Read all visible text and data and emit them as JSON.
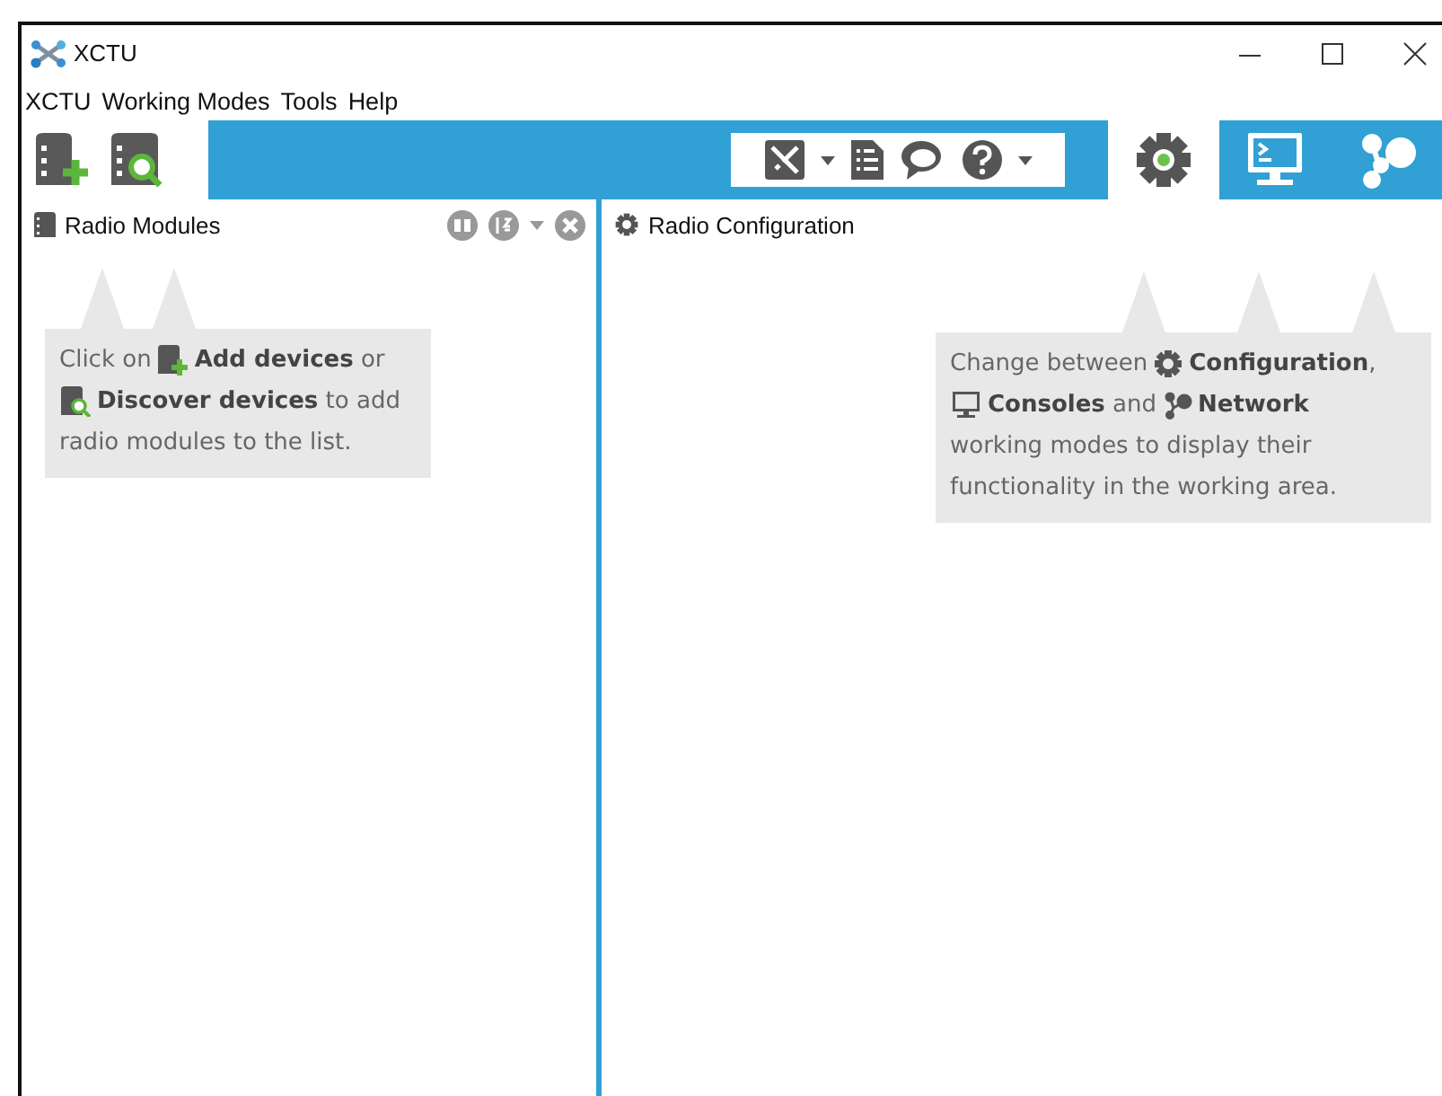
{
  "window": {
    "title": "XCTU"
  },
  "menu": [
    "XCTU",
    "Working Modes",
    "Tools",
    "Help"
  ],
  "device_buttons": [
    {
      "kind": "add"
    },
    {
      "kind": "discover"
    }
  ],
  "tools": [
    {
      "kind": "tools",
      "caret": true
    },
    {
      "kind": "list",
      "caret": false
    },
    {
      "kind": "chat",
      "caret": false
    },
    {
      "kind": "help",
      "caret": true
    }
  ],
  "modes": [
    {
      "kind": "gear",
      "selected": true
    },
    {
      "kind": "console",
      "selected": false
    },
    {
      "kind": "network",
      "selected": false
    }
  ],
  "left_panel": {
    "title": "Radio Modules",
    "hint": [
      [
        {
          "kind": "text",
          "text": "Click on "
        },
        {
          "kind": "add"
        },
        {
          "kind": "text",
          "text": " **Add devices** or"
        }
      ],
      [
        {
          "kind": "discover"
        },
        {
          "kind": "text",
          "text": " **Discover devices** to add"
        }
      ],
      [
        {
          "kind": "text",
          "text": "radio modules to the list."
        }
      ]
    ]
  },
  "right_panel": {
    "title": "Radio Configuration",
    "hint": [
      [
        {
          "kind": "text",
          "text": "Change between "
        },
        {
          "kind": "gear"
        },
        {
          "kind": "text",
          "text": " **Configuration**,"
        }
      ],
      [
        {
          "kind": "console"
        },
        {
          "kind": "text",
          "text": " **Consoles** and "
        },
        {
          "kind": "network"
        },
        {
          "kind": "text",
          "text": " **Network**"
        }
      ],
      [
        {
          "kind": "text",
          "text": "working modes to display their"
        }
      ],
      [
        {
          "kind": "text",
          "text": "functionality in the working area."
        }
      ]
    ]
  }
}
